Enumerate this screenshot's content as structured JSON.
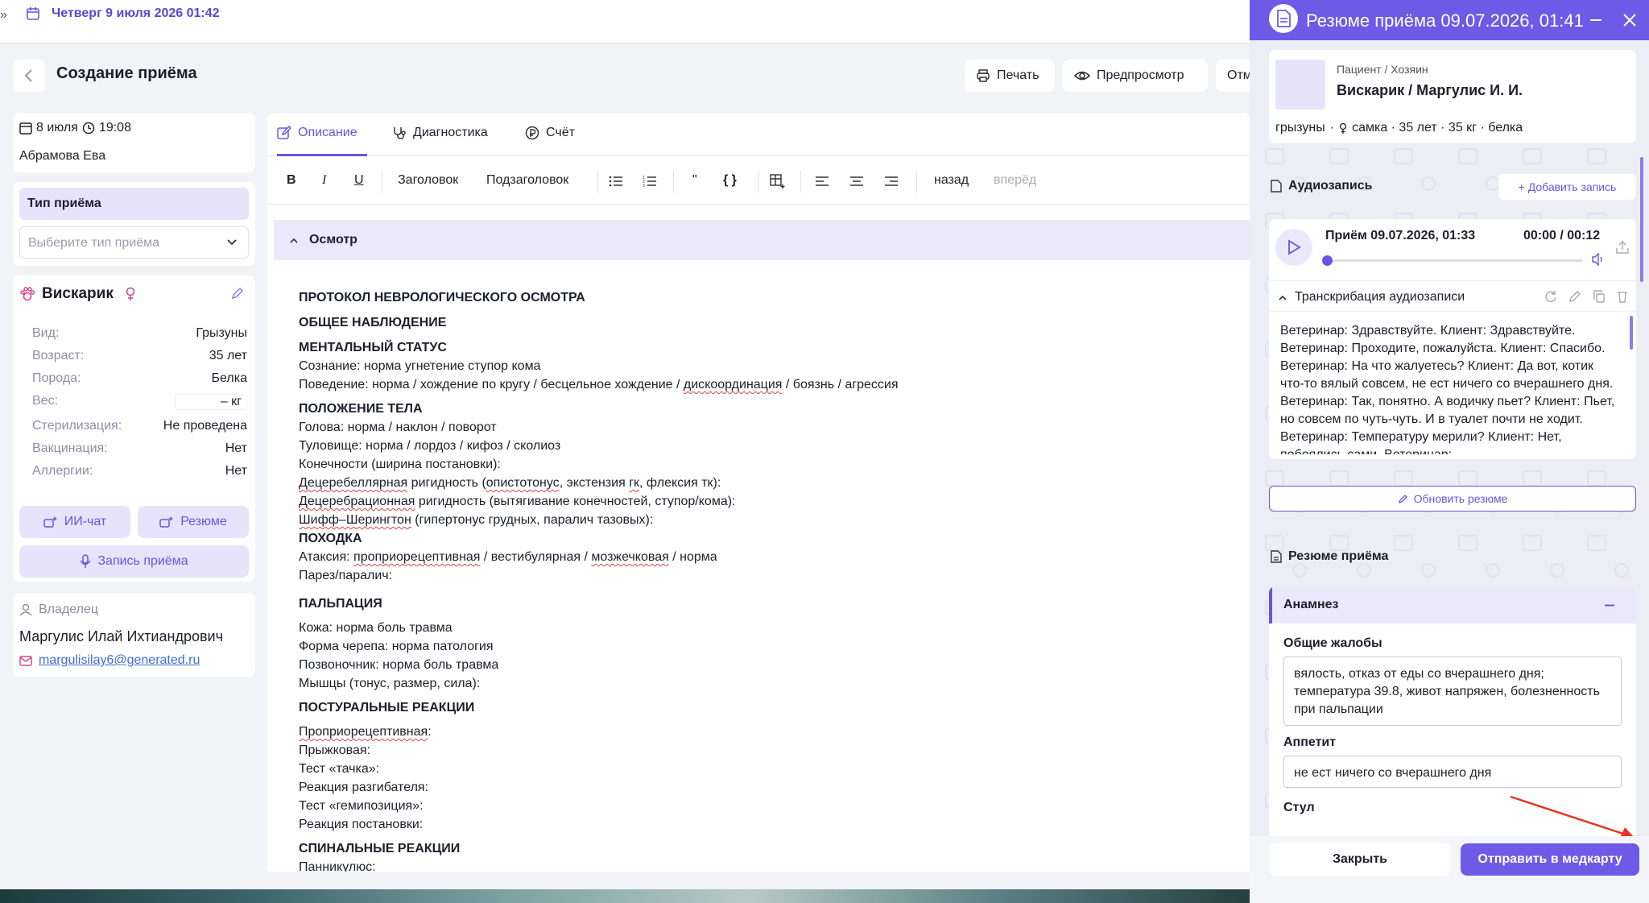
{
  "topbar": {
    "date": "Четверг 9 июля 2026 01:42"
  },
  "header": {
    "title": "Создание приёма",
    "print": "Печать",
    "preview": "Предпросмотр",
    "cancel": "Отм"
  },
  "visit": {
    "date": "8 июля",
    "time": "19:08",
    "doctor": "Абрамова Ева"
  },
  "visit_type": {
    "label": "Тип приёма",
    "placeholder": "Выберите тип приёма"
  },
  "pet": {
    "name": "Вискарик",
    "rows": [
      {
        "k": "Вид:",
        "v": "Грызуны"
      },
      {
        "k": "Возраст:",
        "v": "35 лет"
      },
      {
        "k": "Порода:",
        "v": "Белка"
      },
      {
        "k": "Вес:",
        "v": "– кг"
      },
      {
        "k": "Стерилизация:",
        "v": "Не проведена"
      },
      {
        "k": "Вакцинация:",
        "v": "Нет"
      },
      {
        "k": "Аллергии:",
        "v": "Нет"
      }
    ]
  },
  "actions": {
    "ai_chat": "ИИ-чат",
    "summary": "Резюме",
    "record": "Запись приёма"
  },
  "owner": {
    "label": "Владелец",
    "name": "Маргулис Илай Ихтиандрович",
    "email": "margulisilay6@generated.ru"
  },
  "editor": {
    "tabs": [
      "Описание",
      "Диагностика",
      "Счёт"
    ],
    "toolbar": {
      "heading": "Заголовок",
      "subheading": "Подзаголовок",
      "quote": "\"",
      "code": "{ }",
      "undo": "назад",
      "redo": "вперёд"
    },
    "section": "Осмотр"
  },
  "doc": {
    "title": "ПРОТОКОЛ НЕВРОЛОГИЧЕСКОГО ОСМОТРА",
    "h_general": "ОБЩЕЕ НАБЛЮДЕНИЕ",
    "h_mental": "МЕНТАЛЬНЫЙ СТАТУС",
    "consciousness": "Сознание: норма угнетение ступор кома",
    "behavior_a": "Поведение: норма / хождение по кругу / бесцельное хождение / ",
    "behavior_u": "дискоординация",
    "behavior_b": " / боязнь / агрессия",
    "h_posture": "ПОЛОЖЕНИЕ ТЕЛА",
    "head": "Голова: норма / наклон / поворот",
    "trunk": "Туловище: норма / лордоз / кифоз / сколиоз",
    "limbs": "Конечности (ширина постановки):",
    "decereb1_u": "Децеребеллярная",
    "decereb1_a": " ригидность (",
    "decereb1_u2": "опистотонус",
    "decereb1_b": ", экстензия ",
    "decereb1_u3": "гк",
    "decereb1_c": ", флексия тк):",
    "decereb2_u": "Децеребрационная",
    "decereb2_b": " ригидность (вытягивание конечностей, ступор/кома):",
    "schiff_u": "Шифф–Шерингтон",
    "schiff_b": " (гипертонус грудных, паралич тазовых):",
    "h_gait": "ПОХОДКА",
    "ataxia_a": "Атаксия: ",
    "ataxia_u": "проприорецептивная",
    "ataxia_b": " / вестибулярная / ",
    "ataxia_u2": "мозжечковая",
    "ataxia_c": " / норма",
    "paresis": "Парез/паралич:",
    "h_palp": "ПАЛЬПАЦИЯ",
    "skin": "Кожа: норма боль травма",
    "skull": "Форма черепа: норма патология",
    "spine": "Позвоночник: норма боль травма",
    "muscles": "Мышцы (тонус, размер, сила):",
    "h_postural": "ПОСТУРАЛЬНЫЕ РЕАКЦИИ",
    "propr_u": "Проприорецептивная",
    "propr_b": ":",
    "jump": "Прыжковая:",
    "wheelbarrow": "Тест «тачка»:",
    "extensor": "Реакция разгибателя:",
    "hemi": "Тест «гемипозиция»:",
    "placing": "Реакция постановки:",
    "h_spinal": "СПИНАЛЬНЫЕ РЕАКЦИИ",
    "panniculus": "Панникулюс:"
  },
  "panel": {
    "title": "Резюме приёма 09.07.2026, 01:41",
    "patient_label": "Пациент / Хозяин",
    "patient_name": "Вискарик / Маргулис И. И.",
    "patient_meta_a": "грызуны",
    "patient_meta_b": "самка · 35 лет · 35 кг · белка",
    "audio_label": "Аудиозапись",
    "add_record": "+ Добавить запись",
    "record_title": "Приём 09.07.2026, 01:33",
    "record_time": "00:00 / 00:12",
    "progress": 0,
    "transcript_label": "Транскрибация аудиозаписи",
    "transcript": "Ветеринар: Здравствуйте. Клиент: Здравствуйте. Ветеринар: Проходите, пожалуйста. Клиент: Спасибо. Ветеринар: На что жалуетесь? Клиент: Да вот, котик что-то вялый совсем, не ест ничего со вчерашнего дня. Ветеринар: Так, понятно. А водичку пьет? Клиент: Пьет, но совсем по чуть-чуть. И в туалет почти не ходит. Ветеринар: Температуру мерили? Клиент: Нет, побоялись сами. Ветеринар:",
    "update_summary": "Обновить резюме",
    "summary_label": "Резюме приёма",
    "anamnesis": "Анамнез",
    "complaints_label": "Общие жалобы",
    "complaints": "вялость, отказ от еды со вчерашнего дня; температура 39.8, живот напряжен, болезненность при пальпации",
    "appetite_label": "Аппетит",
    "appetite": "не ест ничего со вчерашнего дня",
    "stool_label": "Стул",
    "close": "Закрыть",
    "send": "Отправить в медкарту"
  }
}
